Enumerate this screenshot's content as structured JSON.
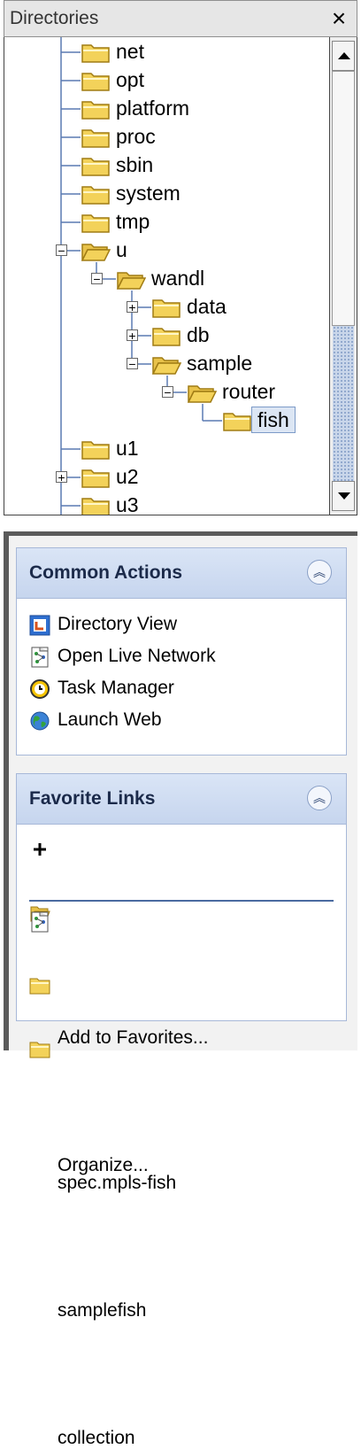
{
  "directories": {
    "title": "Directories",
    "close_glyph": "×",
    "tree": [
      {
        "label": "net",
        "depth": 1,
        "toggle": null,
        "open": false
      },
      {
        "label": "opt",
        "depth": 1,
        "toggle": null,
        "open": false
      },
      {
        "label": "platform",
        "depth": 1,
        "toggle": null,
        "open": false
      },
      {
        "label": "proc",
        "depth": 1,
        "toggle": null,
        "open": false
      },
      {
        "label": "sbin",
        "depth": 1,
        "toggle": null,
        "open": false
      },
      {
        "label": "system",
        "depth": 1,
        "toggle": null,
        "open": false
      },
      {
        "label": "tmp",
        "depth": 1,
        "toggle": null,
        "open": false
      },
      {
        "label": "u",
        "depth": 1,
        "toggle": "−",
        "open": true
      },
      {
        "label": "wandl",
        "depth": 2,
        "toggle": "−",
        "open": true
      },
      {
        "label": "data",
        "depth": 3,
        "toggle": "+",
        "open": false
      },
      {
        "label": "db",
        "depth": 3,
        "toggle": "+",
        "open": false
      },
      {
        "label": "sample",
        "depth": 3,
        "toggle": "−",
        "open": true
      },
      {
        "label": "router",
        "depth": 4,
        "toggle": "−",
        "open": true
      },
      {
        "label": "fish",
        "depth": 5,
        "toggle": null,
        "open": false,
        "selected": true
      },
      {
        "label": "u1",
        "depth": 1,
        "toggle": null,
        "open": false
      },
      {
        "label": "u2",
        "depth": 1,
        "toggle": "+",
        "open": false
      },
      {
        "label": "u3",
        "depth": 1,
        "toggle": null,
        "open": false
      }
    ],
    "colors": {
      "folder": "#f3d25a",
      "folder_edge": "#a07c14",
      "selection": "#dce6f4",
      "tree_line": "#5a7ab2"
    }
  },
  "task_pane": {
    "common_actions": {
      "title": "Common Actions",
      "items": [
        {
          "label": "Directory View",
          "icon": "directory-view-icon"
        },
        {
          "label": "Open Live Network",
          "icon": "live-network-icon"
        },
        {
          "label": "Task Manager",
          "icon": "clock-icon"
        },
        {
          "label": "Launch Web",
          "icon": "globe-icon"
        }
      ]
    },
    "favorite_links": {
      "title": "Favorite Links",
      "actions": [
        {
          "label": "Add to Favorites...",
          "icon": "plus-icon"
        },
        {
          "label": "Organize...",
          "icon": "open-folder-icon"
        }
      ],
      "links": [
        {
          "label": "spec.mpls-fish",
          "icon": "network-file-icon"
        },
        {
          "label": "samplefish",
          "icon": "folder-icon"
        },
        {
          "label": "collection",
          "icon": "folder-icon"
        }
      ]
    },
    "header_gradient": [
      "#dae5f6",
      "#c6d5ee"
    ],
    "accent": "#4a6aa0"
  }
}
